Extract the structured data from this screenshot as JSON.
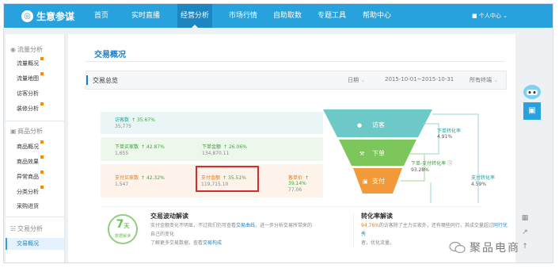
{
  "brand": {
    "name": "生意参谋",
    "logo_glyph": "◎",
    "accent": "#28a2dc"
  },
  "nav": {
    "items": [
      "首页",
      "实时直播",
      "经营分析",
      "市场行情",
      "自助取数",
      "专题工具",
      "帮助中心"
    ],
    "active": "经营分析",
    "user": "个人中心"
  },
  "sidebar": {
    "sections": [
      {
        "title": "流量分析",
        "icon": "eye-icon",
        "items": [
          "流量概况",
          "流量地图",
          "访客分析",
          "装修分析"
        ]
      },
      {
        "title": "商品分析",
        "icon": "box-icon",
        "items": [
          "商品概况",
          "商品效果",
          "异常商品",
          "分类分析",
          "采购进货"
        ]
      },
      {
        "title": "交易分析",
        "icon": "cart-icon",
        "items": [
          "交易概况"
        ]
      }
    ],
    "active_item": "交易概况"
  },
  "page": {
    "title": "交易概况",
    "section_title": "交易总览",
    "date_label": "日期",
    "date_range": "2015-10-01~2015-10-31",
    "terminal": "所有终端"
  },
  "funnel": {
    "rows": [
      {
        "metrics": [
          {
            "name": "访客数",
            "change": "35.67%",
            "value": "35,775"
          }
        ]
      },
      {
        "metrics": [
          {
            "name": "下单买家数",
            "change": "42.87%",
            "value": "1,655"
          },
          {
            "name": "下单金额",
            "change": "26.06%",
            "value": "134,870.11"
          }
        ]
      },
      {
        "metrics": [
          {
            "name": "支付买家数",
            "change": "42.32%",
            "value": "1,547"
          },
          {
            "name": "支付金额",
            "change": "35.51%",
            "value": "119,715.10"
          },
          {
            "name": "客单价",
            "change": "39.14%",
            "value": "77.06"
          }
        ]
      }
    ],
    "stages": [
      "访客",
      "下单",
      "支付"
    ],
    "conversions": {
      "order": {
        "label": "下单转化率",
        "value": "4.91%"
      },
      "order_pay": {
        "label": "下单-支付转化率",
        "value": "93.28%"
      },
      "pay": {
        "label": "支付转化率",
        "value": "4.59%"
      }
    }
  },
  "cards": {
    "trend": {
      "badge_number": "7",
      "badge_unit": "天",
      "badge_text": "数据解读",
      "title": "交易波动解读",
      "line1_a": "支付金额变化不明显，不过我们仍可查看",
      "line1_link": "交易曲线",
      "line1_b": "，进一步分析交易所带来的",
      "line2": "自己的变化",
      "line3_a": "了解更多交易数据，查看",
      "line3_link": "交易构成"
    },
    "conv": {
      "title": "转化率解读",
      "highlight": "94.76%",
      "line1_a": "的访客除了主力买家外，还有哪些同行",
      "line1_b": "，其成交量超过",
      "line1_link": "同行优秀",
      "line2": "者，优化流量。"
    }
  },
  "watermark": "聚品电商"
}
